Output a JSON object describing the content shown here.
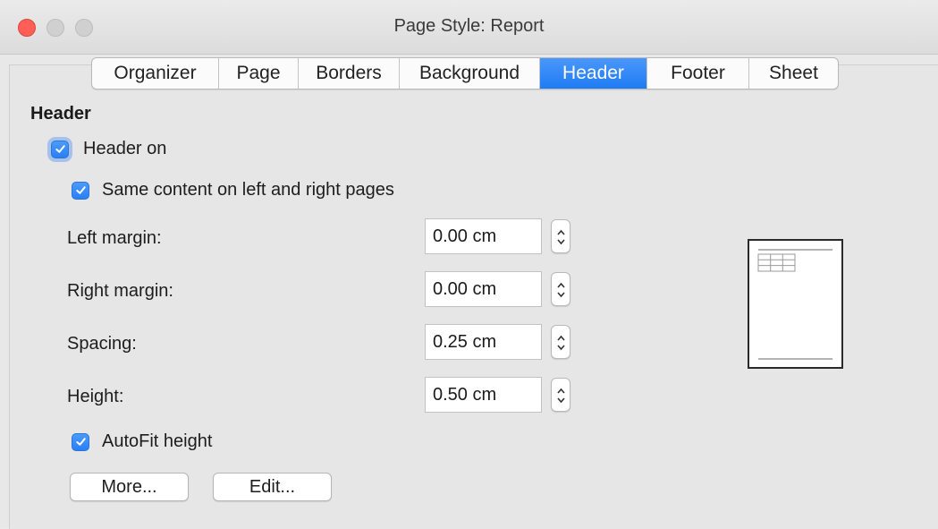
{
  "window": {
    "title": "Page Style: Report"
  },
  "tabs": [
    {
      "label": "Organizer",
      "active": false
    },
    {
      "label": "Page",
      "active": false
    },
    {
      "label": "Borders",
      "active": false
    },
    {
      "label": "Background",
      "active": false
    },
    {
      "label": "Header",
      "active": true
    },
    {
      "label": "Footer",
      "active": false
    },
    {
      "label": "Sheet",
      "active": false
    }
  ],
  "header": {
    "section_title": "Header",
    "header_on": {
      "label": "Header on",
      "checked": true
    },
    "same_content": {
      "label": "Same content on left and right pages",
      "checked": true
    },
    "fields": [
      {
        "label": "Left margin:",
        "value": "0.00 cm"
      },
      {
        "label": "Right margin:",
        "value": "0.00 cm"
      },
      {
        "label": "Spacing:",
        "value": "0.25 cm"
      },
      {
        "label": "Height:",
        "value": "0.50 cm"
      }
    ],
    "autofit": {
      "label": "AutoFit height",
      "checked": true
    },
    "more_label": "More...",
    "edit_label": "Edit..."
  },
  "colors": {
    "accent": "#2a7ff6",
    "close_button": "#ff5f57"
  },
  "icons": [
    "check-icon",
    "spinner-arrows-icon",
    "table-icon"
  ]
}
